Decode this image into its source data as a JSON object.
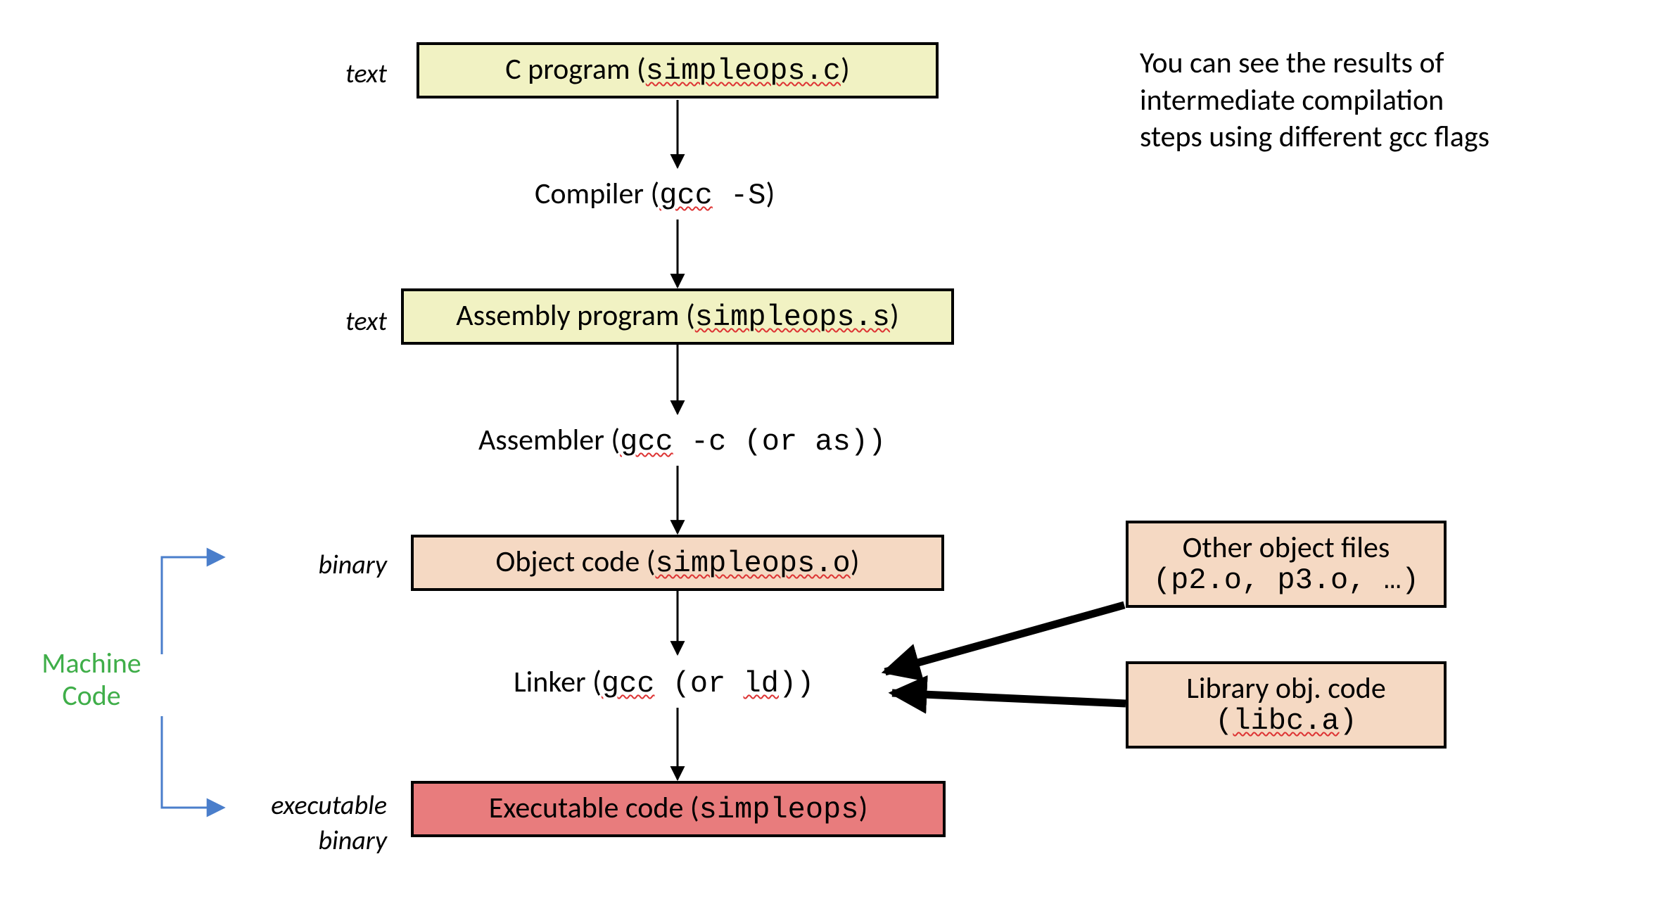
{
  "labels": {
    "text1": "text",
    "text2": "text",
    "binary": "binary",
    "exec1": "executable",
    "exec2": "binary"
  },
  "boxes": {
    "cprog_pre": "C program (",
    "cprog_file": "simpleops.c",
    "cprog_post": ")",
    "asm_pre": "Assembly program (",
    "asm_file": "simpleops.s",
    "asm_post": ")",
    "obj_pre": "Object code (",
    "obj_file": "simpleops.o",
    "obj_post": ")",
    "exe_pre": "Executable code (",
    "exe_file": "simpleops",
    "exe_post": ")",
    "other_line1": "Other object files",
    "other_line2": "(p2.o, p3.o, …)",
    "lib_line1": "Library obj. code",
    "lib_pre": "(",
    "lib_file": "libc.a",
    "lib_post": ")"
  },
  "stages": {
    "compiler_pre": "Compiler (",
    "compiler_cmd": "gcc",
    "compiler_flag": " -S",
    "compiler_post": ")",
    "assembler_pre": "Assembler (",
    "assembler_cmd": "gcc",
    "assembler_flag": " -c",
    "assembler_mid": "  (or ",
    "assembler_alt": "as",
    "assembler_post": "))",
    "linker_pre": "Linker (",
    "linker_cmd": "gcc",
    "linker_mid": "  (or ",
    "linker_alt": "ld",
    "linker_post": "))"
  },
  "machine_code": {
    "line1": "Machine",
    "line2": "Code"
  },
  "note": {
    "line1": "You can see the results of",
    "line2": "intermediate compilation",
    "line3": "steps using different gcc flags"
  }
}
